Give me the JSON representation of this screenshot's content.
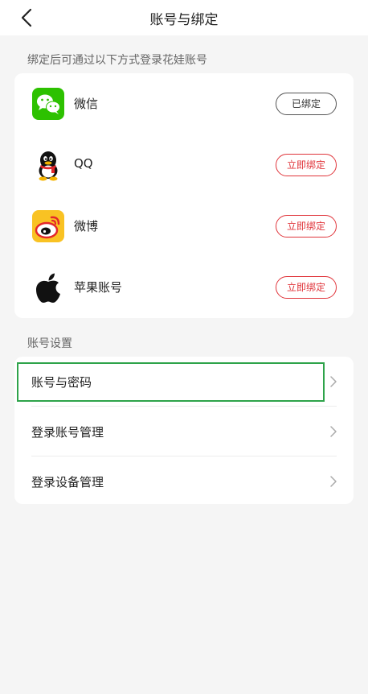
{
  "header": {
    "title": "账号与绑定"
  },
  "binding_section": {
    "heading": "绑定后可通过以下方式登录花娃账号",
    "items": [
      {
        "label": "微信",
        "icon": "wechat-icon",
        "button": "已绑定",
        "bound": true
      },
      {
        "label": "QQ",
        "icon": "qq-icon",
        "button": "立即绑定",
        "bound": false
      },
      {
        "label": "微博",
        "icon": "weibo-icon",
        "button": "立即绑定",
        "bound": false
      },
      {
        "label": "苹果账号",
        "icon": "apple-icon",
        "button": "立即绑定",
        "bound": false
      }
    ]
  },
  "settings_section": {
    "heading": "账号设置",
    "items": [
      {
        "label": "账号与密码",
        "icon": "chevron-right-icon"
      },
      {
        "label": "登录账号管理",
        "icon": "chevron-right-icon"
      },
      {
        "label": "登录设备管理",
        "icon": "chevron-right-icon"
      }
    ]
  },
  "colors": {
    "accent_red": "#e0353b",
    "wechat_green": "#2dc100",
    "highlight_green": "#2ea34a"
  }
}
